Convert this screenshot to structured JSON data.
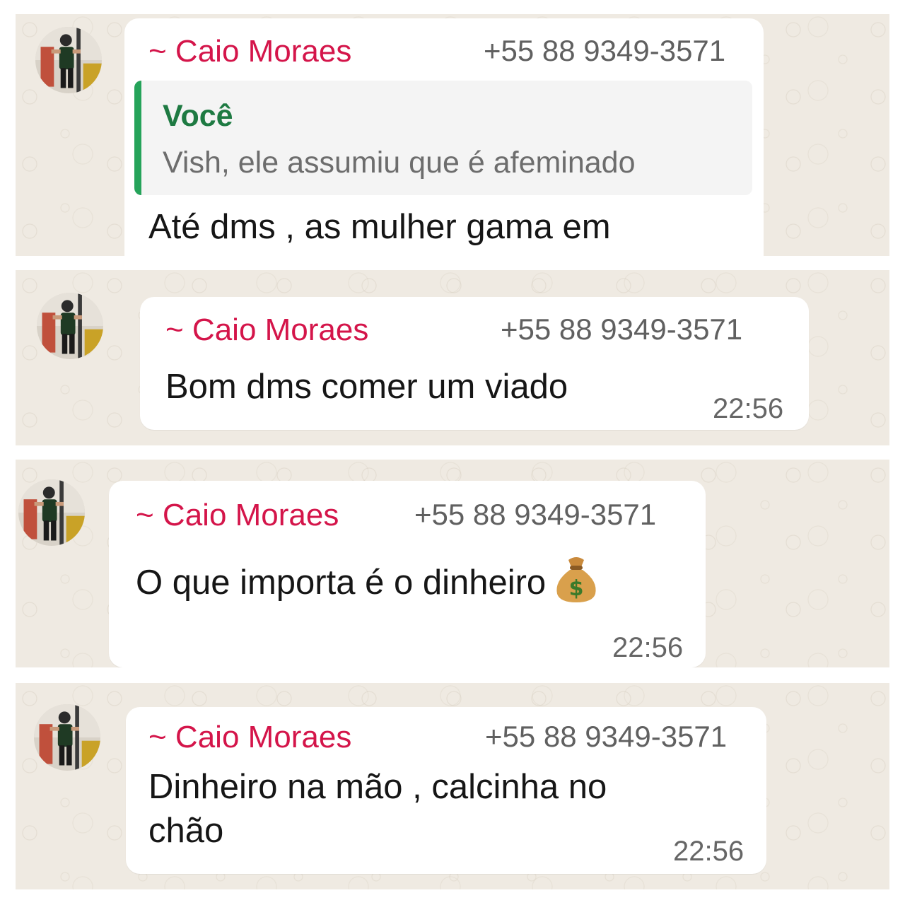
{
  "messages": [
    {
      "sender": "~ Caio Moraes",
      "phone": "+55 88 9349-3571",
      "quote": {
        "author": "Você",
        "text": "Vish, ele assumiu que é afeminado"
      },
      "text": "Até dms , as mulher gama em",
      "time": ""
    },
    {
      "sender": "~ Caio Moraes",
      "phone": "+55 88 9349-3571",
      "text": "Bom dms comer um viado",
      "time": "22:56"
    },
    {
      "sender": "~ Caio Moraes",
      "phone": "+55 88 9349-3571",
      "text": "O que importa é o dinheiro",
      "emoji": "money-bag-icon",
      "time": "22:56"
    },
    {
      "sender": "~ Caio Moraes",
      "phone": "+55 88 9349-3571",
      "text": "Dinheiro na mão , calcinha no chão",
      "time": "22:56"
    }
  ],
  "colors": {
    "sender": "#d4154a",
    "quote_accent": "#25a35a",
    "chat_background": "#efeae2"
  }
}
